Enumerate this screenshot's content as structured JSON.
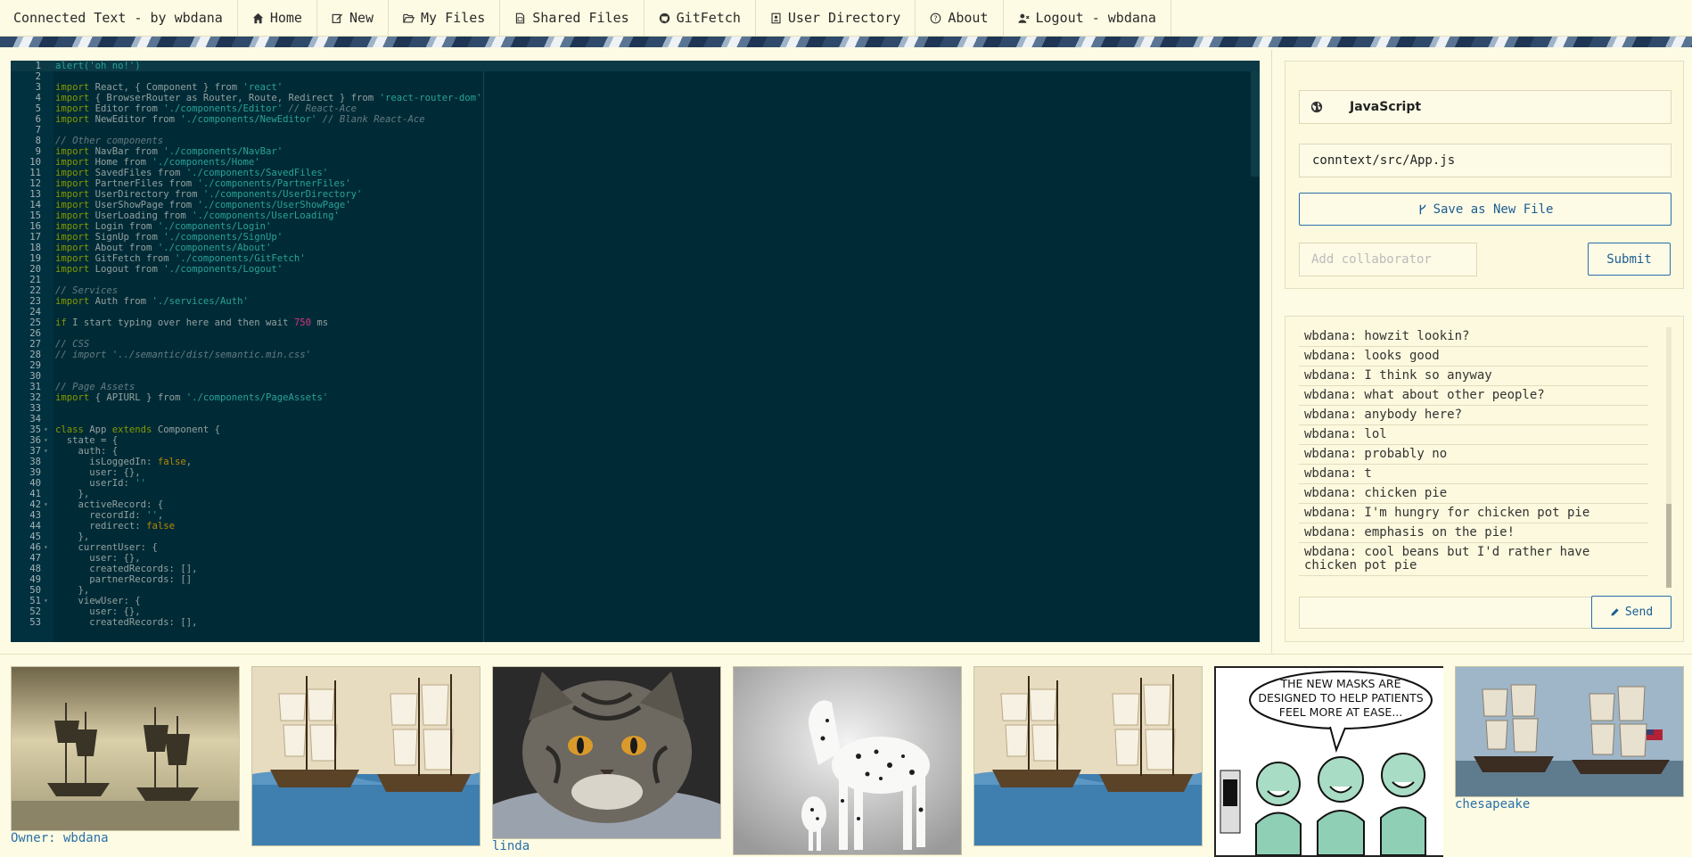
{
  "nav": {
    "brand": "Connected Text - by wbdana",
    "items": [
      {
        "label": "Home",
        "icon": "home-icon"
      },
      {
        "label": "New",
        "icon": "edit-icon"
      },
      {
        "label": "My Files",
        "icon": "folder-open-icon"
      },
      {
        "label": "Shared Files",
        "icon": "file-icon"
      },
      {
        "label": "GitFetch",
        "icon": "github-icon"
      },
      {
        "label": "User Directory",
        "icon": "address-book-icon"
      },
      {
        "label": "About",
        "icon": "question-circle-icon"
      },
      {
        "label": "Logout - wbdana",
        "icon": "user-times-icon"
      }
    ]
  },
  "editor": {
    "lines": [
      [
        {
          "t": "alert('oh no!')",
          "c": "c-str"
        }
      ],
      [],
      [
        {
          "t": "import",
          "c": "c-kw"
        },
        {
          "t": " React, { Component } from "
        },
        {
          "t": "'react'",
          "c": "c-str"
        }
      ],
      [
        {
          "t": "import",
          "c": "c-kw"
        },
        {
          "t": " { BrowserRouter as Router, Route, Redirect } from "
        },
        {
          "t": "'react-router-dom'",
          "c": "c-str"
        }
      ],
      [
        {
          "t": "import",
          "c": "c-kw"
        },
        {
          "t": " Editor from "
        },
        {
          "t": "'./components/Editor'",
          "c": "c-str"
        },
        {
          "t": " // React-Ace",
          "c": "c-cm"
        }
      ],
      [
        {
          "t": "import",
          "c": "c-kw"
        },
        {
          "t": " NewEditor from "
        },
        {
          "t": "'./components/NewEditor'",
          "c": "c-str"
        },
        {
          "t": " // Blank React-Ace",
          "c": "c-cm"
        }
      ],
      [],
      [
        {
          "t": "// Other components",
          "c": "c-cm"
        }
      ],
      [
        {
          "t": "import",
          "c": "c-kw"
        },
        {
          "t": " NavBar from "
        },
        {
          "t": "'./components/NavBar'",
          "c": "c-str"
        }
      ],
      [
        {
          "t": "import",
          "c": "c-kw"
        },
        {
          "t": " Home from "
        },
        {
          "t": "'./components/Home'",
          "c": "c-str"
        }
      ],
      [
        {
          "t": "import",
          "c": "c-kw"
        },
        {
          "t": " SavedFiles from "
        },
        {
          "t": "'./components/SavedFiles'",
          "c": "c-str"
        }
      ],
      [
        {
          "t": "import",
          "c": "c-kw"
        },
        {
          "t": " PartnerFiles from "
        },
        {
          "t": "'./components/PartnerFiles'",
          "c": "c-str"
        }
      ],
      [
        {
          "t": "import",
          "c": "c-kw"
        },
        {
          "t": " UserDirectory from "
        },
        {
          "t": "'./components/UserDirectory'",
          "c": "c-str"
        }
      ],
      [
        {
          "t": "import",
          "c": "c-kw"
        },
        {
          "t": " UserShowPage from "
        },
        {
          "t": "'./components/UserShowPage'",
          "c": "c-str"
        }
      ],
      [
        {
          "t": "import",
          "c": "c-kw"
        },
        {
          "t": " UserLoading from "
        },
        {
          "t": "'./components/UserLoading'",
          "c": "c-str"
        }
      ],
      [
        {
          "t": "import",
          "c": "c-kw"
        },
        {
          "t": " Login from "
        },
        {
          "t": "'./components/Login'",
          "c": "c-str"
        }
      ],
      [
        {
          "t": "import",
          "c": "c-kw"
        },
        {
          "t": " SignUp from "
        },
        {
          "t": "'./components/SignUp'",
          "c": "c-str"
        }
      ],
      [
        {
          "t": "import",
          "c": "c-kw"
        },
        {
          "t": " About from "
        },
        {
          "t": "'./components/About'",
          "c": "c-str"
        }
      ],
      [
        {
          "t": "import",
          "c": "c-kw"
        },
        {
          "t": " GitFetch from "
        },
        {
          "t": "'./components/GitFetch'",
          "c": "c-str"
        }
      ],
      [
        {
          "t": "import",
          "c": "c-kw"
        },
        {
          "t": " Logout from "
        },
        {
          "t": "'./components/Logout'",
          "c": "c-str"
        }
      ],
      [],
      [
        {
          "t": "// Services",
          "c": "c-cm"
        }
      ],
      [
        {
          "t": "import",
          "c": "c-kw"
        },
        {
          "t": " Auth from "
        },
        {
          "t": "'./services/Auth'",
          "c": "c-str"
        }
      ],
      [],
      [
        {
          "t": "if",
          "c": "c-kw"
        },
        {
          "t": " I start typing over here and then wait "
        },
        {
          "t": "750",
          "c": "c-num"
        },
        {
          "t": " ms"
        }
      ],
      [],
      [
        {
          "t": "// CSS",
          "c": "c-cm"
        }
      ],
      [
        {
          "t": "// import '../semantic/dist/semantic.min.css'",
          "c": "c-cm"
        }
      ],
      [],
      [],
      [
        {
          "t": "// Page Assets",
          "c": "c-cm"
        }
      ],
      [
        {
          "t": "import",
          "c": "c-kw"
        },
        {
          "t": " { APIURL } from "
        },
        {
          "t": "'./components/PageAssets'",
          "c": "c-str"
        }
      ],
      [],
      [],
      [
        {
          "t": "class",
          "c": "c-kw"
        },
        {
          "t": " App "
        },
        {
          "t": "extends",
          "c": "c-kw"
        },
        {
          "t": " Component {"
        }
      ],
      [
        {
          "t": "  state = {"
        }
      ],
      [
        {
          "t": "    auth: {"
        }
      ],
      [
        {
          "t": "      isLoggedIn: "
        },
        {
          "t": "false",
          "c": "c-bool"
        },
        {
          "t": ","
        }
      ],
      [
        {
          "t": "      user: {},"
        }
      ],
      [
        {
          "t": "      userId: "
        },
        {
          "t": "''",
          "c": "c-str"
        }
      ],
      [
        {
          "t": "    },"
        }
      ],
      [
        {
          "t": "    activeRecord: {"
        }
      ],
      [
        {
          "t": "      recordId: "
        },
        {
          "t": "''",
          "c": "c-str"
        },
        {
          "t": ","
        }
      ],
      [
        {
          "t": "      redirect: "
        },
        {
          "t": "false",
          "c": "c-bool"
        }
      ],
      [
        {
          "t": "    },"
        }
      ],
      [
        {
          "t": "    currentUser: {"
        }
      ],
      [
        {
          "t": "      user: {},"
        }
      ],
      [
        {
          "t": "      createdRecords: [],"
        }
      ],
      [
        {
          "t": "      partnerRecords: []"
        }
      ],
      [
        {
          "t": "    },"
        }
      ],
      [
        {
          "t": "    viewUser: {"
        }
      ],
      [
        {
          "t": "      user: {},"
        }
      ],
      [
        {
          "t": "      createdRecords: [],"
        }
      ]
    ],
    "folds": [
      35,
      36,
      37,
      42,
      46,
      51
    ]
  },
  "file": {
    "language": "JavaScript",
    "language_icon": "globe-icon",
    "path": "conntext/src/App.js",
    "save_label": "Save as New File",
    "collaborator_placeholder": "Add collaborator",
    "submit_label": "Submit"
  },
  "chat": {
    "messages": [
      "wbdana: howzit lookin?",
      "wbdana: looks good",
      "wbdana: I think so anyway",
      "wbdana: what about other people?",
      "wbdana: anybody here?",
      "wbdana: lol",
      "wbdana: probably no",
      "wbdana: t",
      "wbdana: chicken pie",
      "wbdana: I'm hungry for chicken pot pie",
      "wbdana: emphasis on the pie!",
      "wbdana: cool beans but I'd rather have chicken pot pie"
    ],
    "send_label": "Send"
  },
  "gallery": [
    {
      "caption": "Owner: wbdana",
      "image": "sailing-ships-sepia-painting"
    },
    {
      "caption": "",
      "image": "naval-battle-painting"
    },
    {
      "caption": "linda",
      "image": "tabby-cat-photo"
    },
    {
      "caption": "",
      "image": "spotted-horse-and-dalmatian-photo"
    },
    {
      "caption": "",
      "image": "naval-battle-painting"
    },
    {
      "caption": "",
      "image": "masks-comic",
      "comic_text": "THE NEW MASKS ARE DESIGNED TO HELP PATIENTS FEEL MORE AT EASE..."
    },
    {
      "caption": "chesapeake",
      "image": "frigates-battle-painting"
    }
  ]
}
